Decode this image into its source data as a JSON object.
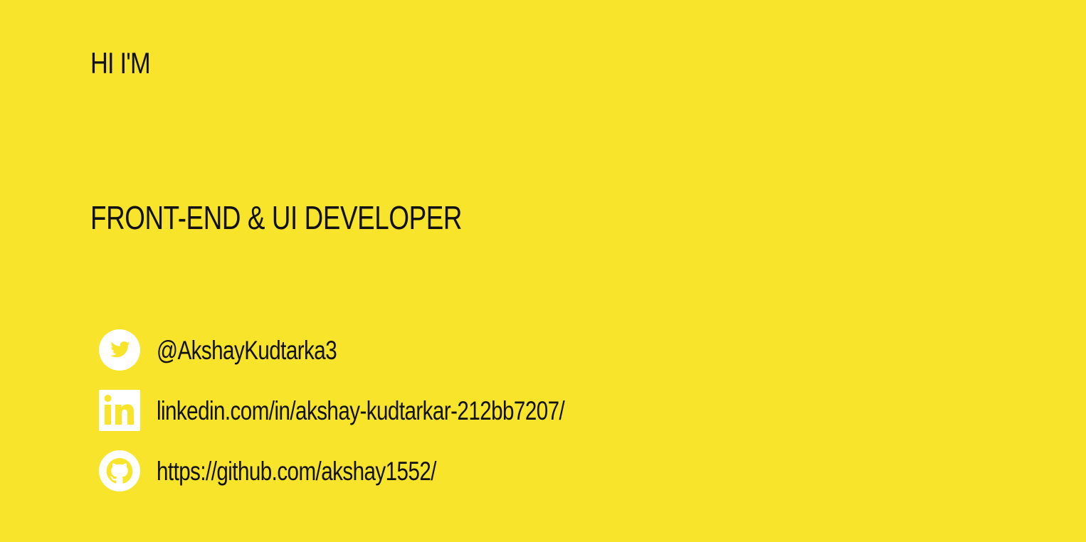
{
  "hero": {
    "greeting": "HI I'M",
    "role": "FRONT-END & UI DEVELOPER"
  },
  "social": [
    {
      "icon": "twitter-icon",
      "label": "@AkshayKudtarka3"
    },
    {
      "icon": "linkedin-icon",
      "label": "linkedin.com/in/akshay-kudtarkar-212bb7207/"
    },
    {
      "icon": "github-icon",
      "label": "https://github.com/akshay1552/"
    }
  ],
  "colors": {
    "background": "#f7e42b",
    "text": "#111111",
    "icon": "#ffffff"
  }
}
